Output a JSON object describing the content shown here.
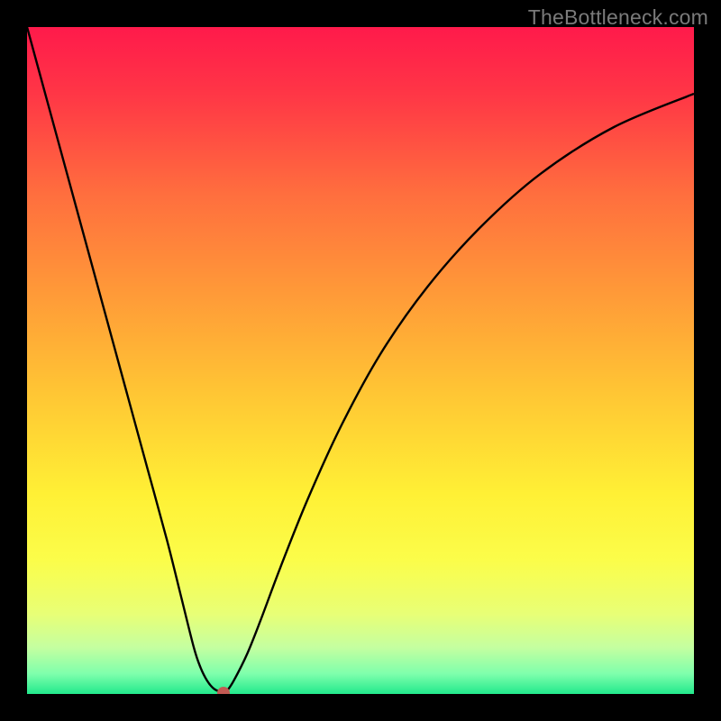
{
  "watermark": "TheBottleneck.com",
  "chart_data": {
    "type": "line",
    "title": "",
    "xlabel": "",
    "ylabel": "",
    "xlim": [
      0,
      100
    ],
    "ylim": [
      0,
      100
    ],
    "grid": false,
    "legend": false,
    "background_gradient": {
      "stops": [
        {
          "offset": 0.0,
          "color": "#ff1a4b"
        },
        {
          "offset": 0.1,
          "color": "#ff3646"
        },
        {
          "offset": 0.25,
          "color": "#ff6e3e"
        },
        {
          "offset": 0.4,
          "color": "#ff9a38"
        },
        {
          "offset": 0.55,
          "color": "#ffc634"
        },
        {
          "offset": 0.7,
          "color": "#fff035"
        },
        {
          "offset": 0.8,
          "color": "#fbfd4a"
        },
        {
          "offset": 0.88,
          "color": "#e8ff76"
        },
        {
          "offset": 0.93,
          "color": "#c5ffa0"
        },
        {
          "offset": 0.97,
          "color": "#7effac"
        },
        {
          "offset": 1.0,
          "color": "#22e98c"
        }
      ]
    },
    "series": [
      {
        "name": "bottleneck-curve",
        "color": "#000000",
        "x": [
          0,
          3,
          6,
          9,
          12,
          15,
          18,
          21,
          23,
          25,
          26,
          27,
          28,
          29,
          29.5,
          30,
          31,
          33,
          35,
          38,
          42,
          47,
          53,
          60,
          68,
          77,
          88,
          100
        ],
        "y": [
          100,
          89,
          78,
          67,
          56,
          45,
          34,
          23,
          15,
          7,
          4,
          2,
          0.8,
          0.3,
          0.15,
          0.5,
          2,
          6,
          11,
          19,
          29,
          40,
          51,
          61,
          70,
          78,
          85,
          90
        ]
      }
    ],
    "marker": {
      "x": 29.5,
      "y": 0.15,
      "color": "#c25a53"
    }
  }
}
